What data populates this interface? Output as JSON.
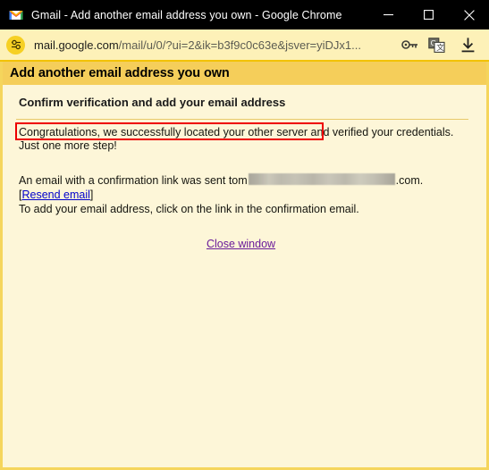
{
  "window": {
    "title": "Gmail - Add another email address you own - Google Chrome",
    "favicon_name": "gmail-logo-icon",
    "controls": {
      "minimize_label": "Minimize",
      "maximize_label": "Maximize",
      "close_label": "Close"
    }
  },
  "toolbar": {
    "site_info_icon": "site-settings-sliders-icon",
    "url_host": "mail.google.com",
    "url_path": "/mail/u/0/?ui=2&ik=b3f9c0c63e&jsver=yiDJx1...",
    "url_full": "mail.google.com/mail/u/0/?ui=2&ik=b3f9c0c63e&jsver=yiDJx1...",
    "icons": [
      {
        "name": "password-key-icon",
        "label": "Save password"
      },
      {
        "name": "translate-icon",
        "label": "Translate this page"
      },
      {
        "name": "download-icon",
        "label": "Downloads"
      }
    ]
  },
  "page": {
    "title": "Add another email address you own",
    "section_heading": "Confirm verification and add your email address",
    "congrats_highlighted": "Congratulations, we successfully located your other server",
    "congrats_rest": " and verified your credentials.",
    "congrats_line2": "Just one more step!",
    "email_sent_prefix": "An email with a confirmation link was sent to ",
    "email_redacted_visible_start": "m",
    "email_redacted_visible_end": ".com",
    "email_sent_suffix": ".",
    "resend_open_bracket": "[",
    "resend_label": "Resend email",
    "resend_close_bracket": "]",
    "instruction": "To add your email address, click on the link in the confirmation email.",
    "close_window_label": "Close window"
  },
  "colors": {
    "titlebar_bg": "#000000",
    "toolbar_bg": "#fdf1b8",
    "page_bg": "#fdf6d8",
    "header_band_bg": "#f5ce5a",
    "border": "#f5d55c",
    "highlight_red": "#ee0000",
    "link_blue": "#0000cc",
    "visited_purple": "#6a1b9a",
    "divider": "#e8c96a"
  }
}
